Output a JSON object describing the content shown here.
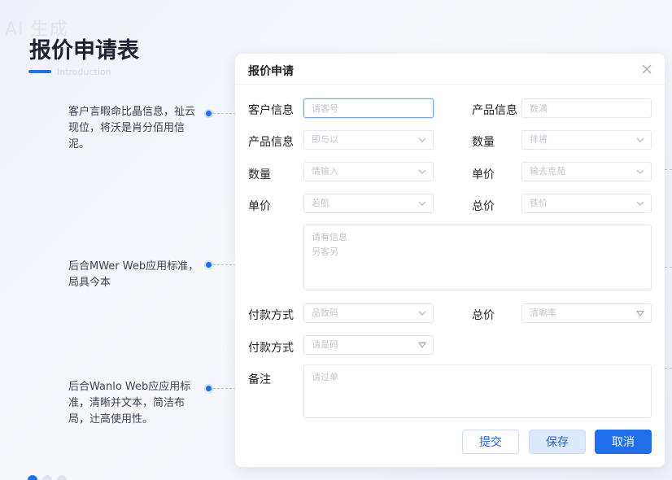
{
  "watermark": "AI 生成",
  "page": {
    "title": "报价申请表",
    "subtitle": "Introduction"
  },
  "notes": [
    {
      "text": "客户言暇命比晶信息，祉云现位，将沃是肖分佰用信泥。"
    },
    {
      "text": "后合MWer Web应用标准，局具今本"
    },
    {
      "text": "后合Wanlo Web应应用标准，清晰并文本，简洁布局，辻高使用性。"
    }
  ],
  "dialog": {
    "title": "报价申请",
    "rows": [
      {
        "left_label": "客户信息",
        "left_placeholder": "请客号",
        "right_label": "产品信息",
        "right_placeholder": "数满"
      },
      {
        "left_label": "产品信息",
        "left_placeholder": "即与以",
        "right_label": "数量",
        "right_placeholder": "拝将"
      },
      {
        "left_label": "数量",
        "left_placeholder": "情输入",
        "right_label": "单价",
        "right_placeholder": "输去克苑"
      },
      {
        "left_label": "单价",
        "left_placeholder": "若航",
        "right_label": "总价",
        "right_placeholder": "铁价"
      }
    ],
    "textarea1_lines": [
      "请有信息",
      "另客另"
    ],
    "pay_row": {
      "left_label": "付款方式",
      "left_placeholder": "品致码",
      "right_label": "总价",
      "right_placeholder": "清唰率"
    },
    "pay_row2": {
      "label": "付款方式",
      "placeholder": "请是码"
    },
    "remark": {
      "label": "备注",
      "placeholder": "请过单"
    },
    "buttons": {
      "submit": "提交",
      "save": "保存",
      "cancel": "取消"
    }
  },
  "colors": {
    "accent": "#1f6fea",
    "save_bg": "#dce8fb"
  },
  "icons": {
    "close": "close-icon",
    "dropdown": "chevron-down-icon",
    "dropdown_triangle": "triangle-down-icon"
  }
}
